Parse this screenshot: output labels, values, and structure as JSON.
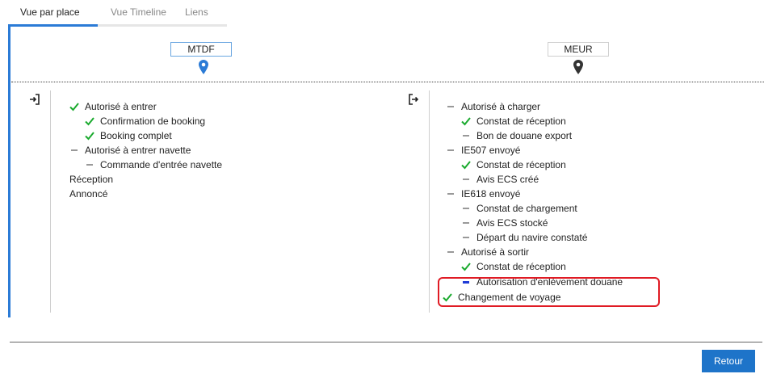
{
  "tabs": [
    {
      "label": "Vue par place",
      "active": true
    },
    {
      "label": "Vue Timeline",
      "active": false
    },
    {
      "label": "Liens",
      "active": false
    }
  ],
  "places": {
    "left": {
      "code": "MTDF",
      "icon": "map-pin-icon",
      "color": "#2b7bd6"
    },
    "right": {
      "code": "MEUR",
      "icon": "map-pin-icon",
      "color": "#333333"
    }
  },
  "left_tree": {
    "direction_icon": "enter-icon",
    "items": [
      {
        "label": "Autorisé à entrer",
        "status": "done",
        "level": 0
      },
      {
        "label": "Confirmation de booking",
        "status": "done",
        "level": 1
      },
      {
        "label": "Booking complet",
        "status": "done",
        "level": 1
      },
      {
        "label": "Autorisé à entrer navette",
        "status": "pending",
        "level": 0
      },
      {
        "label": "Commande d'entrée navette",
        "status": "pending",
        "level": 1
      },
      {
        "label": "Réception",
        "status": "none",
        "level": 0
      },
      {
        "label": "Annoncé",
        "status": "none",
        "level": 0
      }
    ]
  },
  "right_tree": {
    "direction_icon": "exit-icon",
    "items": [
      {
        "label": "Autorisé à charger",
        "status": "pending",
        "level": 0
      },
      {
        "label": "Constat de réception",
        "status": "done",
        "level": 1
      },
      {
        "label": "Bon de douane export",
        "status": "pending",
        "level": 1
      },
      {
        "label": "IE507 envoyé",
        "status": "pending",
        "level": 0
      },
      {
        "label": "Constat de réception",
        "status": "done",
        "level": 1
      },
      {
        "label": "Avis ECS créé",
        "status": "pending",
        "level": 1
      },
      {
        "label": "IE618 envoyé",
        "status": "pending",
        "level": 0
      },
      {
        "label": "Constat de chargement",
        "status": "pending",
        "level": 1
      },
      {
        "label": "Avis ECS stocké",
        "status": "pending",
        "level": 1
      },
      {
        "label": "Départ du navire constaté",
        "status": "pending",
        "level": 1
      },
      {
        "label": "Autorisé à sortir",
        "status": "pending",
        "level": 0
      },
      {
        "label": "Constat de réception",
        "status": "done",
        "level": 1
      },
      {
        "label": "Autorisation d'enlèvement douane",
        "status": "in-progress",
        "level": 1
      },
      {
        "label": "Changement de voyage",
        "status": "done",
        "level": -1
      }
    ]
  },
  "footer": {
    "button_label": "Retour"
  },
  "colors": {
    "accent": "#2b7bd6",
    "check": "#1aaa2e",
    "pending": "#999999",
    "in_progress": "#1f3bd6",
    "highlight": "#e01b24"
  }
}
